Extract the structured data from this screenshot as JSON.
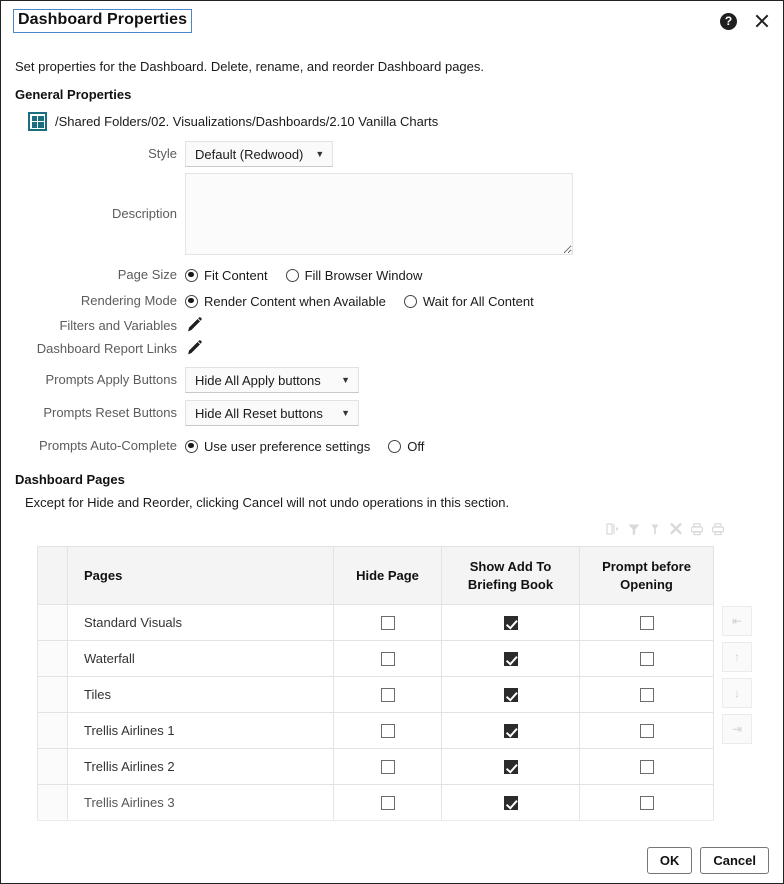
{
  "dialog": {
    "title": "Dashboard Properties",
    "help_icon": "help-circle-icon",
    "close_icon": "close-icon",
    "intro": "Set properties for the Dashboard. Delete, rename, and reorder Dashboard pages."
  },
  "general": {
    "heading": "General Properties",
    "path_icon": "dashboard-grid-icon",
    "path": "/Shared Folders/02. Visualizations/Dashboards/2.10 Vanilla Charts",
    "style": {
      "label": "Style",
      "value": "Default (Redwood)",
      "caret": "▼"
    },
    "description": {
      "label": "Description",
      "value": "",
      "placeholder": ""
    },
    "page_size": {
      "label": "Page Size",
      "options": [
        {
          "label": "Fit Content",
          "selected": true
        },
        {
          "label": "Fill Browser Window",
          "selected": false
        }
      ]
    },
    "rendering_mode": {
      "label": "Rendering Mode",
      "options": [
        {
          "label": "Render Content when Available",
          "selected": true
        },
        {
          "label": "Wait for All Content",
          "selected": false
        }
      ]
    },
    "filters_and_variables": {
      "label": "Filters and Variables",
      "icon": "pencil-edit-icon"
    },
    "dashboard_report_links": {
      "label": "Dashboard Report Links",
      "icon": "pencil-edit-icon"
    },
    "prompts_apply_buttons": {
      "label": "Prompts Apply Buttons",
      "value": "Hide All Apply buttons",
      "caret": "▼"
    },
    "prompts_reset_buttons": {
      "label": "Prompts Reset Buttons",
      "value": "Hide All Reset buttons",
      "caret": "▼"
    },
    "prompts_auto_complete": {
      "label": "Prompts Auto-Complete",
      "options": [
        {
          "label": "Use user preference settings",
          "selected": true
        },
        {
          "label": "Off",
          "selected": false
        }
      ]
    }
  },
  "pages_section": {
    "heading": "Dashboard Pages",
    "note": "Except for Hide and Reorder, clicking Cancel will not undo operations in this section.",
    "toolbar_icons": [
      "copy-page-icon",
      "filter-icon",
      "remove-filter-icon",
      "delete-icon",
      "print-pdf-icon",
      "print-html-icon"
    ],
    "table": {
      "columns": [
        "",
        "Pages",
        "Hide Page",
        "Show Add To Briefing Book",
        "Prompt before Opening"
      ],
      "rows": [
        {
          "name": "Standard Visuals",
          "hide_page": false,
          "show_add_to_briefing_book": true,
          "prompt_before_opening": false,
          "partial": false
        },
        {
          "name": "Waterfall",
          "hide_page": false,
          "show_add_to_briefing_book": true,
          "prompt_before_opening": false,
          "partial": false
        },
        {
          "name": "Tiles",
          "hide_page": false,
          "show_add_to_briefing_book": true,
          "prompt_before_opening": false,
          "partial": false
        },
        {
          "name": "Trellis Airlines 1",
          "hide_page": false,
          "show_add_to_briefing_book": true,
          "prompt_before_opening": false,
          "partial": false
        },
        {
          "name": "Trellis Airlines 2",
          "hide_page": false,
          "show_add_to_briefing_book": true,
          "prompt_before_opening": false,
          "partial": false
        },
        {
          "name": "Trellis Airlines 3",
          "hide_page": false,
          "show_add_to_briefing_book": true,
          "prompt_before_opening": false,
          "partial": true
        }
      ]
    },
    "reorder_buttons": [
      {
        "name": "move-to-top-button",
        "glyph": "⇤"
      },
      {
        "name": "move-up-button",
        "glyph": "↑"
      },
      {
        "name": "move-down-button",
        "glyph": "↓"
      },
      {
        "name": "move-to-bottom-button",
        "glyph": "⇥"
      }
    ]
  },
  "footer": {
    "ok_label": "OK",
    "cancel_label": "Cancel"
  },
  "colors": {
    "focus_outline": "#4a86c8",
    "icon_teal": "#1b6e80",
    "checkbox_checked": "#2b2b2b",
    "header_bg": "#f4f4f4"
  }
}
